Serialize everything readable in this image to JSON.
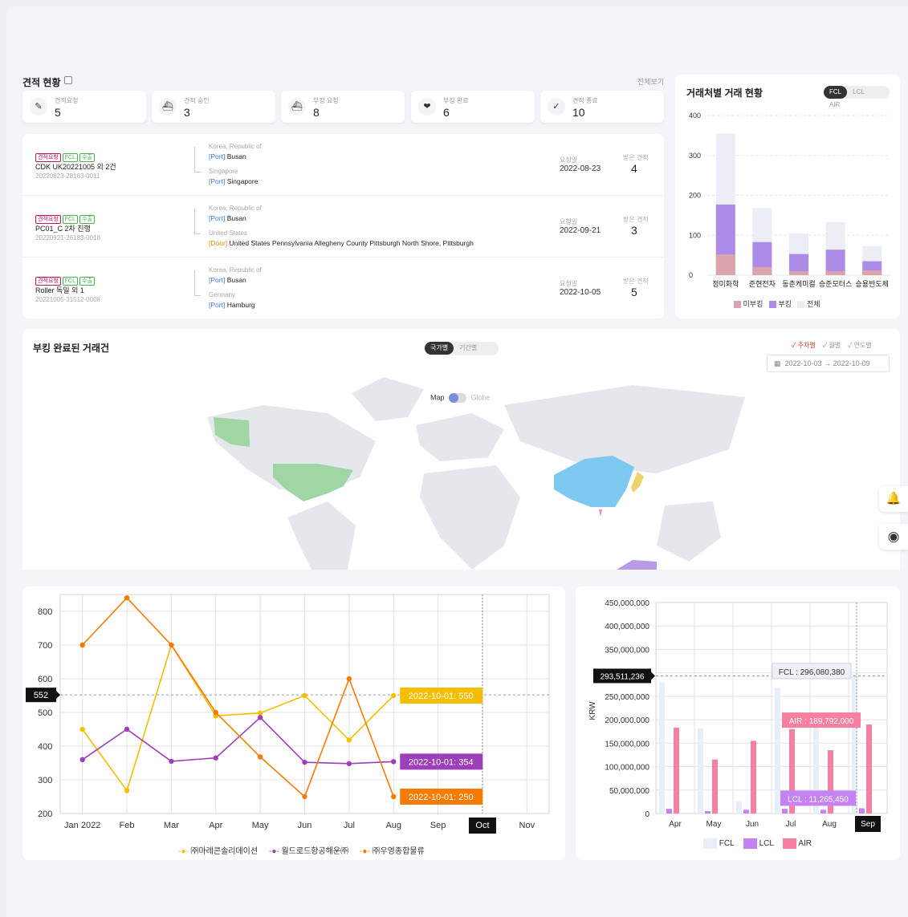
{
  "quotes_section": {
    "title": "견적 현황",
    "view_all": "전체보기",
    "stats": [
      {
        "label": "견적요청",
        "value": "5",
        "icon": "edit-icon"
      },
      {
        "label": "견적 승인",
        "value": "3",
        "icon": "ship-icon"
      },
      {
        "label": "부킹 요청",
        "value": "8",
        "icon": "ship-icon"
      },
      {
        "label": "부킹 완료",
        "value": "6",
        "icon": "handshake-icon"
      },
      {
        "label": "견적 종료",
        "value": "10",
        "icon": "check-icon"
      }
    ],
    "rows": [
      {
        "tags": [
          "견적요청",
          "FCL",
          "수출"
        ],
        "name": "CDK UK20221005 외 2건",
        "id": "20220823-28163-0011",
        "origin_country": "Korea, Republic of",
        "origin_type": "[Port]",
        "origin_place": "Busan",
        "dest_country": "Singapore",
        "dest_type": "[Port]",
        "dest_place": "Singapore",
        "date_label": "요청일",
        "date": "2022-08-23",
        "received_label": "받은 견적",
        "received": "4"
      },
      {
        "tags": [
          "견적요청",
          "FCL",
          "수출"
        ],
        "name": "PC01_C 2차 진행",
        "id": "20220921-26183-0018",
        "origin_country": "Korea, Republic of",
        "origin_type": "[Port]",
        "origin_place": "Busan",
        "dest_country": "United States",
        "dest_type": "[Door]",
        "dest_place": "United States Pennsylvania Allegheny County Pittsburgh North Shore, Pittsburgh",
        "date_label": "요청일",
        "date": "2022-09-21",
        "received_label": "받은 견적",
        "received": "3"
      },
      {
        "tags": [
          "견적요청",
          "FCL",
          "수출"
        ],
        "name": "Roller 독일 외 1",
        "id": "20221005-31512-0008",
        "origin_country": "Korea, Republic of",
        "origin_type": "[Port]",
        "origin_place": "Busan",
        "dest_country": "Germany",
        "dest_type": "[Port]",
        "dest_place": "Hamburg",
        "date_label": "요청일",
        "date": "2022-10-05",
        "received_label": "받은 견적",
        "received": "5"
      }
    ]
  },
  "partner_section": {
    "title": "거래처별 거래 현황",
    "tabs": [
      "FCL",
      "LCL",
      "AIR"
    ],
    "active_tab": "FCL",
    "legend": [
      "미부킹",
      "부킹",
      "전체"
    ]
  },
  "booked_section": {
    "title": "부킹 완료된 거래건",
    "view_tabs": [
      "국가별",
      "기간별"
    ],
    "active_view": "국가별",
    "period_filters": [
      "주차별",
      "월별",
      "연도별"
    ],
    "active_period": "주차별",
    "date_from": "2022-10-03",
    "date_to": "2022-10-09",
    "map_toggle": {
      "left": "Map",
      "right": "Globe"
    }
  },
  "colors": {
    "sub1": "#f5bf00",
    "sub2": "#9c3fb8",
    "sub3": "#f57c00",
    "fcl": "#e9eefb",
    "lcl": "#c483f0",
    "air": "#f77fa1",
    "unbooked": "#dba3ad",
    "booked": "#ad8ce8",
    "total": "#eceef5"
  },
  "chart_data": [
    {
      "type": "bar",
      "title": "거래처별 거래 현황",
      "categories": [
        "정미화학",
        "준현전자",
        "동춘케미컬",
        "승준모터스",
        "승용반도체"
      ],
      "ylim": [
        0,
        400
      ],
      "yticks": [
        "0",
        "100",
        "200",
        "300",
        "400"
      ],
      "series": [
        {
          "name": "미부킹",
          "values": [
            52,
            20,
            10,
            10,
            12
          ]
        },
        {
          "name": "부킹",
          "values": [
            177,
            83,
            53,
            64,
            35
          ]
        },
        {
          "name": "전체",
          "values": [
            355,
            168,
            105,
            133,
            73
          ]
        }
      ]
    },
    {
      "type": "line",
      "x": [
        "Jan 2022",
        "Feb",
        "Mar",
        "Apr",
        "May",
        "Jun",
        "Jul",
        "Aug",
        "Sep",
        "Oct",
        "Nov"
      ],
      "ylim": [
        200,
        850
      ],
      "yticks": [
        "200",
        "300",
        "400",
        "500",
        "600",
        "700",
        "800"
      ],
      "crosshair_y": "552",
      "crosshair_x": "Oct",
      "series": [
        {
          "name": "㈜마레콘솔리데이션",
          "values": [
            450,
            268,
            700,
            490,
            498,
            550,
            418,
            550
          ],
          "tooltip": "2022-10-01: 550"
        },
        {
          "name": "월드로드항공해운㈜",
          "values": [
            360,
            450,
            355,
            365,
            485,
            352,
            348,
            354
          ],
          "tooltip": "2022-10-01: 354"
        },
        {
          "name": "㈜우영종합물류",
          "values": [
            700,
            840,
            700,
            500,
            368,
            250,
            600,
            250
          ],
          "tooltip": "2022-10-01: 250"
        }
      ]
    },
    {
      "type": "bar",
      "x": [
        "Apr",
        "May",
        "Jun",
        "Jul",
        "Aug",
        "Sep"
      ],
      "ylabel": "KRW",
      "ylim": [
        0,
        450000000
      ],
      "yticks": [
        "0",
        "50,000,000",
        "100,000,000",
        "150,000,000",
        "200,000,000",
        "250,000,000",
        "300,000,000",
        "350,000,000",
        "400,000,000",
        "450,000,000"
      ],
      "crosshair_y": "293,511,236",
      "crosshair_x": "Sep",
      "series": [
        {
          "name": "FCL",
          "values": [
            280000000,
            182000000,
            25000000,
            268000000,
            210000000,
            296080380
          ],
          "tooltip": "FCL : 296,080,380"
        },
        {
          "name": "LCL",
          "values": [
            10000000,
            5000000,
            8000000,
            10000000,
            8000000,
            11265450
          ],
          "tooltip": "LCL : 11,265,450"
        },
        {
          "name": "AIR",
          "values": [
            183000000,
            115000000,
            155000000,
            180000000,
            135000000,
            189792000
          ],
          "tooltip": "AIR : 189,792,000"
        }
      ]
    }
  ]
}
